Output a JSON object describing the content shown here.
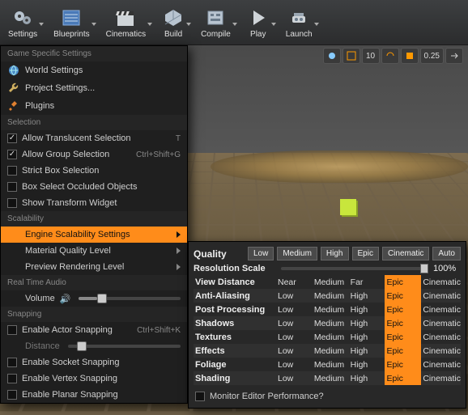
{
  "toolbar": [
    {
      "label": "Settings",
      "icon": "gears",
      "caret": true
    },
    {
      "label": "Blueprints",
      "icon": "blueprint",
      "caret": true
    },
    {
      "label": "Cinematics",
      "icon": "clapper",
      "caret": true
    },
    {
      "label": "Build",
      "icon": "build",
      "caret": true
    },
    {
      "label": "Compile",
      "icon": "compile",
      "caret": true
    },
    {
      "label": "Play",
      "icon": "play",
      "caret": true
    },
    {
      "label": "Launch",
      "icon": "launch",
      "caret": true
    }
  ],
  "viewport_strip": {
    "items": [
      "grid",
      "snap",
      "grid3",
      "angle",
      "surf"
    ],
    "values": [
      "10",
      "",
      "0.25",
      ""
    ]
  },
  "menu": {
    "sections": [
      {
        "header": "Game Specific Settings",
        "items": [
          {
            "type": "cmd",
            "icon": "world",
            "label": "World Settings"
          },
          {
            "type": "cmd",
            "icon": "wrench",
            "label": "Project Settings..."
          },
          {
            "type": "cmd",
            "icon": "plug",
            "label": "Plugins"
          }
        ]
      },
      {
        "header": "Selection",
        "items": [
          {
            "type": "check",
            "checked": true,
            "label": "Allow Translucent Selection",
            "shortcut": "T"
          },
          {
            "type": "check",
            "checked": true,
            "label": "Allow Group Selection",
            "shortcut": "Ctrl+Shift+G"
          },
          {
            "type": "check",
            "checked": false,
            "label": "Strict Box Selection"
          },
          {
            "type": "check",
            "checked": false,
            "label": "Box Select Occluded Objects"
          },
          {
            "type": "check",
            "checked": false,
            "label": "Show Transform Widget"
          }
        ]
      },
      {
        "header": "Scalability",
        "items": [
          {
            "type": "sub",
            "label": "Engine Scalability Settings",
            "hl": true
          },
          {
            "type": "sub",
            "label": "Material Quality Level"
          },
          {
            "type": "sub",
            "label": "Preview Rendering Level"
          }
        ]
      },
      {
        "header": "Real Time Audio",
        "items": [
          {
            "type": "volume",
            "label": "Volume",
            "value": 18
          }
        ]
      },
      {
        "header": "Snapping",
        "items": [
          {
            "type": "check",
            "checked": false,
            "label": "Enable Actor Snapping",
            "shortcut": "Ctrl+Shift+K"
          },
          {
            "type": "distance",
            "label": "Distance",
            "value": 8
          },
          {
            "type": "check",
            "checked": false,
            "label": "Enable Socket Snapping"
          },
          {
            "type": "check",
            "checked": false,
            "label": "Enable Vertex Snapping"
          },
          {
            "type": "check",
            "checked": false,
            "label": "Enable Planar Snapping"
          }
        ]
      }
    ]
  },
  "scalability": {
    "title": "Quality",
    "presets": [
      "Low",
      "Medium",
      "High",
      "Epic",
      "Cinematic",
      "Auto"
    ],
    "resolution": {
      "label": "Resolution Scale",
      "value": "100%",
      "pos": 100
    },
    "rows": [
      {
        "name": "View Distance",
        "opts": [
          "Near",
          "Medium",
          "Far",
          "Epic",
          "Cinematic"
        ],
        "sel": 3
      },
      {
        "name": "Anti-Aliasing",
        "opts": [
          "Low",
          "Medium",
          "High",
          "Epic",
          "Cinematic"
        ],
        "sel": 3
      },
      {
        "name": "Post Processing",
        "opts": [
          "Low",
          "Medium",
          "High",
          "Epic",
          "Cinematic"
        ],
        "sel": 3
      },
      {
        "name": "Shadows",
        "opts": [
          "Low",
          "Medium",
          "High",
          "Epic",
          "Cinematic"
        ],
        "sel": 3
      },
      {
        "name": "Textures",
        "opts": [
          "Low",
          "Medium",
          "High",
          "Epic",
          "Cinematic"
        ],
        "sel": 3
      },
      {
        "name": "Effects",
        "opts": [
          "Low",
          "Medium",
          "High",
          "Epic",
          "Cinematic"
        ],
        "sel": 3
      },
      {
        "name": "Foliage",
        "opts": [
          "Low",
          "Medium",
          "High",
          "Epic",
          "Cinematic"
        ],
        "sel": 3
      },
      {
        "name": "Shading",
        "opts": [
          "Low",
          "Medium",
          "High",
          "Epic",
          "Cinematic"
        ],
        "sel": 3
      }
    ],
    "monitor": {
      "label": "Monitor Editor Performance?",
      "checked": false
    }
  }
}
